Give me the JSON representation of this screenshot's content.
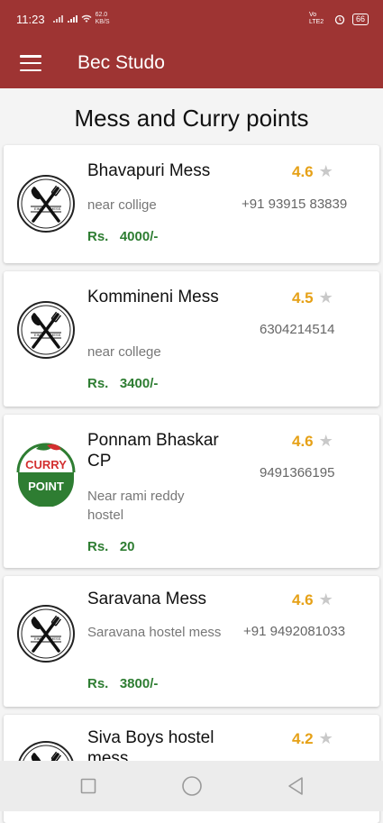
{
  "status": {
    "time": "11:23",
    "net": "62.0 KB/S",
    "volte": "Vo LTE2",
    "battery": "66"
  },
  "appbar": {
    "title": "Bec Studo",
    "menu_icon": "menu-icon"
  },
  "page": {
    "title": "Mess and Curry points"
  },
  "colors": {
    "primary": "#9e3433",
    "price": "#2e7d32",
    "rating": "#e6a117"
  },
  "items": [
    {
      "name": "Bhavapuri Mess",
      "location": "near collige",
      "price": "Rs.   4000/-",
      "rating": "4.6",
      "phone": "+91 93915 83839",
      "logo": "utensils-logo",
      "logo_text_left": "EIM",
      "logo_text_right": "MESS"
    },
    {
      "name": "Kommineni Mess",
      "location": "near college",
      "price": "Rs.   3400/-",
      "rating": "4.5",
      "phone": "6304214514",
      "logo": "utensils-logo",
      "logo_text_left": "EIM",
      "logo_text_right": "MESS"
    },
    {
      "name": "Ponnam Bhaskar CP",
      "location": "Near rami reddy hostel",
      "price": "Rs.   20",
      "rating": "4.6",
      "phone": "9491366195",
      "logo": "curry-point-logo",
      "logo_text_top": "CURRY",
      "logo_text_bottom": "POINT"
    },
    {
      "name": "Saravana Mess",
      "location": "Saravana hostel mess",
      "price": "Rs.   3800/-",
      "rating": "4.6",
      "phone": "+91 9492081033",
      "logo": "utensils-logo",
      "logo_text_left": "EIM",
      "logo_text_right": "MESS"
    },
    {
      "name": "Siva Boys hostel mess",
      "rating": "4.2",
      "logo": "utensils-logo",
      "logo_text_left": "EIM",
      "logo_text_right": "MESS"
    }
  ],
  "navbar": {
    "recents": "square-icon",
    "home": "circle-icon",
    "back": "triangle-icon"
  }
}
